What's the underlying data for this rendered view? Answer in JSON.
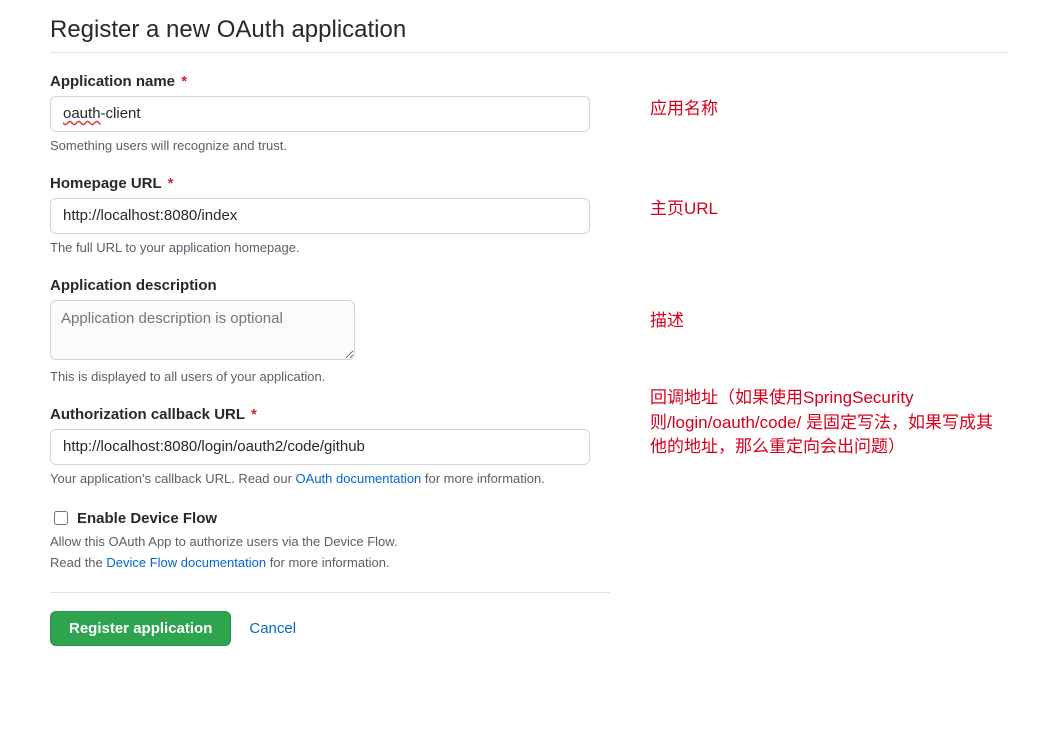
{
  "title": "Register a new OAuth application",
  "fields": {
    "app_name": {
      "label": "Application name",
      "required": "*",
      "value_prefix": "oauth",
      "value_suffix": "-client",
      "hint": "Something users will recognize and trust."
    },
    "homepage": {
      "label": "Homepage URL",
      "required": "*",
      "value": "http://localhost:8080/index",
      "hint": "The full URL to your application homepage."
    },
    "description": {
      "label": "Application description",
      "placeholder": "Application description is optional",
      "hint": "This is displayed to all users of your application."
    },
    "callback": {
      "label": "Authorization callback URL",
      "required": "*",
      "value": "http://localhost:8080/login/oauth2/code/github",
      "hint_prefix": "Your application's callback URL. Read our ",
      "hint_link": "OAuth documentation",
      "hint_suffix": " for more information."
    },
    "device_flow": {
      "label": "Enable Device Flow",
      "hint1": "Allow this OAuth App to authorize users via the Device Flow.",
      "hint2_prefix": "Read the ",
      "hint2_link": "Device Flow documentation",
      "hint2_suffix": " for more information."
    }
  },
  "buttons": {
    "register": "Register application",
    "cancel": "Cancel"
  },
  "annotations": {
    "a1": "应用名称",
    "a2": "主页URL",
    "a3": "描述",
    "a4": "回调地址（如果使用SpringSecurity则/login/oauth/code/            是固定写法，如果写成其他的地址，那么重定向会出问题）"
  }
}
